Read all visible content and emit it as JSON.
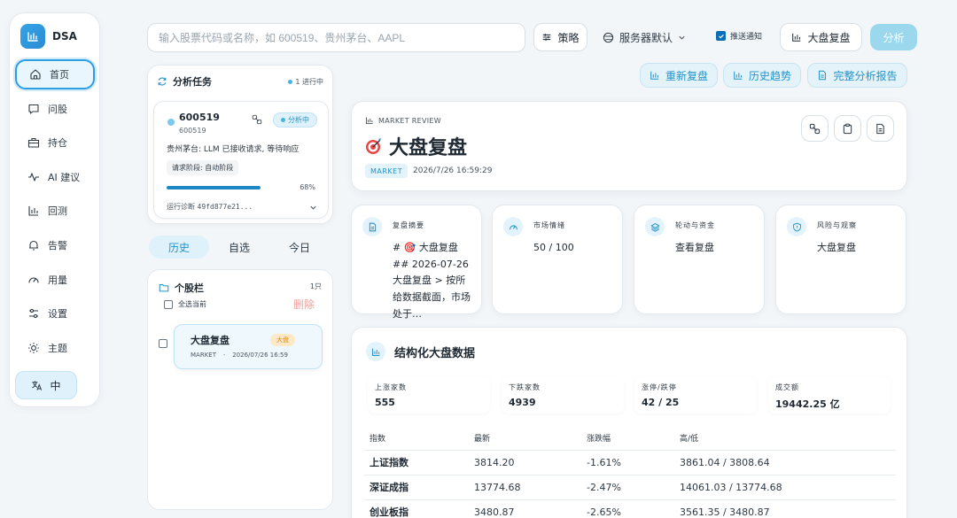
{
  "app": {
    "name": "DSA"
  },
  "sidebar": {
    "items": [
      {
        "label": "首页",
        "icon": "home-icon"
      },
      {
        "label": "问股",
        "icon": "chat-icon"
      },
      {
        "label": "持仓",
        "icon": "briefcase-icon"
      },
      {
        "label": "AI 建议",
        "icon": "pulse-icon"
      },
      {
        "label": "回测",
        "icon": "bar-chart-icon"
      },
      {
        "label": "告警",
        "icon": "bell-icon"
      },
      {
        "label": "用量",
        "icon": "gauge-icon"
      },
      {
        "label": "设置",
        "icon": "sliders-icon"
      },
      {
        "label": "主题",
        "icon": "sun-icon"
      }
    ],
    "language": "中"
  },
  "topbar": {
    "search_placeholder": "输入股票代码或名称，如 600519、贵州茅台、AAPL",
    "strategy": "策略",
    "server": "服务器默认",
    "push_label": "推送通知",
    "push_checked": true,
    "review_button": "大盘复盘",
    "analyze_button": "分析"
  },
  "tasks": {
    "title": "分析任务",
    "running": "1 进行中",
    "card": {
      "code": "600519",
      "sub": "600519",
      "status": "分析中",
      "message": "贵州茅台: LLM 已接收请求, 等待响应",
      "stage": "请求阶段: 自动阶段",
      "progress": 68,
      "progress_label": "68%",
      "diag_label": "运行诊断",
      "diag_id": "49fd877e21..."
    }
  },
  "tabs": [
    "历史",
    "自选",
    "今日"
  ],
  "watchlist": {
    "title": "个股栏",
    "count": "1只",
    "select_all": "全选当前",
    "delete": "删除",
    "items": [
      {
        "name": "大盘复盘",
        "tag": "大盘",
        "market": "MARKET",
        "time": "2026/07/26 16:59"
      }
    ]
  },
  "actions": {
    "rereview": "重新复盘",
    "history": "历史趋势",
    "full_report": "完整分析报告"
  },
  "review": {
    "kicker": "MARKET REVIEW",
    "title": "大盘复盘",
    "market": "MARKET",
    "time": "2026/7/26 16:59:29"
  },
  "summary": [
    {
      "label": "复盘摘要",
      "value": "# 🎯 大盘复盘 ## 2026-07-26 大盘复盘 > 按所给数据截面，市场处于…",
      "icon": "document-icon"
    },
    {
      "label": "市场情绪",
      "value": "50 / 100",
      "icon": "gauge-icon"
    },
    {
      "label": "轮动与资金",
      "value": "查看复盘",
      "icon": "layers-icon"
    },
    {
      "label": "风险与观察",
      "value": "大盘复盘",
      "icon": "shield-icon"
    }
  ],
  "structured": {
    "title": "结构化大盘数据",
    "stats": [
      {
        "label": "上涨家数",
        "value": "555"
      },
      {
        "label": "下跌家数",
        "value": "4939"
      },
      {
        "label": "涨停/跌停",
        "value": "42 / 25"
      },
      {
        "label": "成交额",
        "value": "19442.25 亿"
      }
    ],
    "headers": [
      "指数",
      "最新",
      "涨跌幅",
      "高/低"
    ],
    "rows": [
      [
        "上证指数",
        "3814.20",
        "-1.61%",
        "3861.04 / 3808.64"
      ],
      [
        "深证成指",
        "13774.68",
        "-2.47%",
        "14061.03 / 13774.68"
      ],
      [
        "创业板指",
        "3480.87",
        "-2.65%",
        "3561.35 / 3480.87"
      ]
    ]
  },
  "colors": {
    "accent": "#2d9ee0",
    "accent_light": "#dff2fb",
    "danger": "#f0a0a0"
  }
}
